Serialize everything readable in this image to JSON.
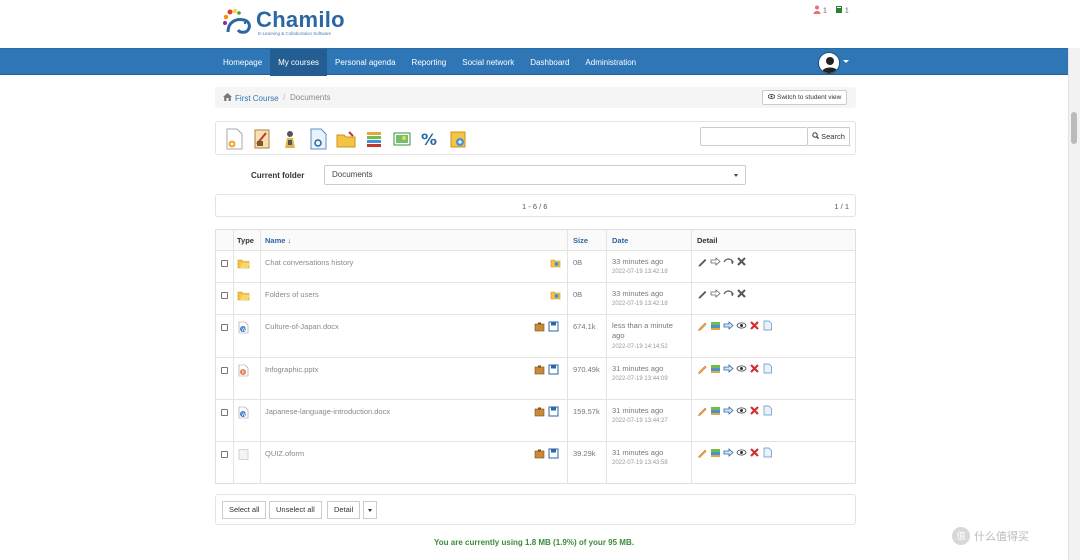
{
  "header": {
    "logo_name": "Chamilo",
    "logo_tagline": "E-Learning & Collaboration Software",
    "online_users_count": "1",
    "messages_count": "1"
  },
  "nav": {
    "items": [
      "Homepage",
      "My courses",
      "Personal agenda",
      "Reporting",
      "Social network",
      "Dashboard",
      "Administration"
    ],
    "active_index": 1
  },
  "breadcrumb": {
    "course": "First Course",
    "current": "Documents",
    "student_view_button": "Switch to student view"
  },
  "toolbar": {
    "icons": [
      "create-document-icon",
      "create-template-icon",
      "upload-icon",
      "create-draw-icon",
      "create-folder-icon",
      "download-all-icon",
      "slideshow-icon",
      "quota-icon",
      "learning-path-icon"
    ],
    "search_placeholder": "",
    "search_button": "Search"
  },
  "folder": {
    "label": "Current folder",
    "selected": "Documents"
  },
  "pager": {
    "range": "1 - 6 / 6",
    "page": "1 / 1"
  },
  "table": {
    "headers": {
      "type": "Type",
      "name": "Name ↓",
      "size": "Size",
      "date": "Date",
      "detail": "Detail"
    },
    "rows": [
      {
        "name": "Chat conversations history",
        "size": "0B",
        "date": "33 minutes ago",
        "timestamp": "2022-07-19 13:42:18",
        "kind": "folder"
      },
      {
        "name": "Folders of users",
        "size": "0B",
        "date": "33 minutes ago",
        "timestamp": "2022-07-19 13:42:18",
        "kind": "folder"
      },
      {
        "name": "Culture-of-Japan.docx",
        "size": "674.1k",
        "date": "less than a minute ago",
        "timestamp": "2022-07-19 14:14:52",
        "kind": "doc"
      },
      {
        "name": "Infographic.pptx",
        "size": "970.49k",
        "date": "31 minutes ago",
        "timestamp": "2022-07-19 13:44:09",
        "kind": "ppt"
      },
      {
        "name": "Japanese-language-introduction.docx",
        "size": "159.57k",
        "date": "31 minutes ago",
        "timestamp": "2022-07-19 13:44:27",
        "kind": "doc"
      },
      {
        "name": "QUIZ.oform",
        "size": "39.29k",
        "date": "31 minutes ago",
        "timestamp": "2022-07-19 13:43:58",
        "kind": "file"
      }
    ]
  },
  "actions": {
    "select_all": "Select all",
    "unselect_all": "Unselect all",
    "detail": "Detail"
  },
  "quota": {
    "message": "You are currently using 1.8 MB (1.9%) of your 95 MB."
  },
  "watermark": {
    "text": "什么值得买",
    "badge": "值"
  },
  "colors": {
    "navbar": "#2f76b7",
    "link": "#2b67a3",
    "quota_text": "#3c8a3c"
  }
}
